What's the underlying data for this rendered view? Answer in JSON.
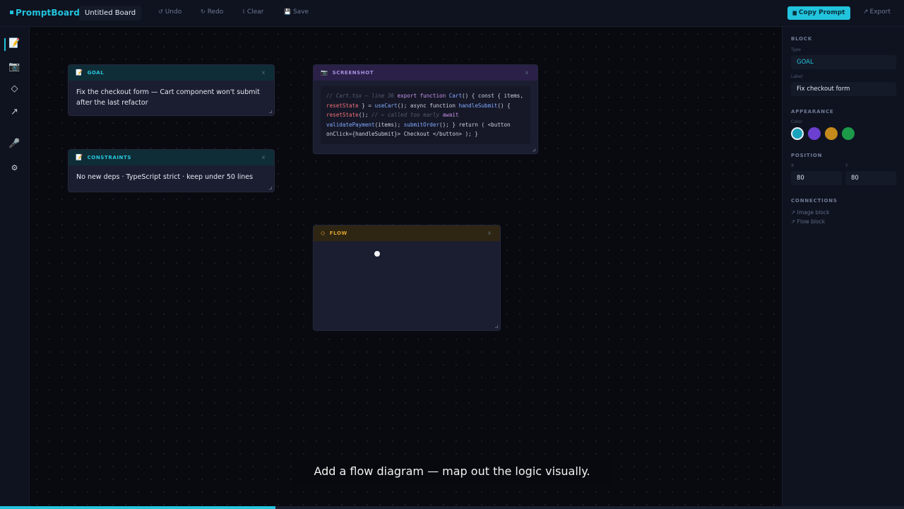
{
  "app": {
    "name": "PromptBoard",
    "board_name": "Untitled Board"
  },
  "toolbar": {
    "undo_icon": "↺",
    "undo_label": "Undo",
    "redo_icon": "↻",
    "redo_label": "Redo",
    "clear_icon": "⌇",
    "clear_label": "Clear",
    "save_icon": "💾",
    "save_label": "Save",
    "copy_prompt_icon": "▆",
    "copy_prompt_label": "Copy Prompt",
    "export_icon": "↗",
    "export_label": "Export"
  },
  "leftbar": {
    "items": [
      {
        "name": "text-block-tool",
        "icon": "📝"
      },
      {
        "name": "image-block-tool",
        "icon": "📷"
      },
      {
        "name": "flow-block-tool",
        "icon": "◇"
      },
      {
        "name": "arrow-tool",
        "icon": "↗"
      },
      {
        "name": "voice-tool",
        "icon": "🎤"
      },
      {
        "name": "settings-tool",
        "icon": "⚙"
      }
    ]
  },
  "blocks": {
    "goal": {
      "icon": "📝",
      "title": "GOAL",
      "close": "x",
      "body": "Fix the checkout form — Cart component won't submit after the last refactor"
    },
    "constraints": {
      "icon": "📝",
      "title": "CONSTRAINTS",
      "close": "x",
      "body": "No new deps · TypeScript strict · keep under 50 lines"
    },
    "screenshot": {
      "icon": "📷",
      "title": "SCREENSHOT",
      "close": "x",
      "code": {
        "c1": "// Cart.tsx — line 36",
        "t1": " export function ",
        "f1": "Cart",
        "t2": "() { const { items, ",
        "v1": "resetState",
        "t3": " } = ",
        "f2": "useCart",
        "t4": "(); async function ",
        "f3": "handleSubmit",
        "t5": "() { ",
        "v2": "resetState",
        "t6": "(); ",
        "c2": "// ← called too early",
        "k1": " await",
        "t7": " ",
        "f4": "validatePayment",
        "t8": "(items); ",
        "f5": "submitOrder",
        "t9": "(); } return ( <button onClick={handleSubmit}> Checkout </button> ); }"
      }
    },
    "flow": {
      "icon": "◇",
      "title": "FLOW",
      "close": "x"
    }
  },
  "panel": {
    "block_section": "BLOCK",
    "type_label": "Type",
    "type_value": "GOAL",
    "label_label": "Label",
    "label_value": "Fix checkout form",
    "appearance_section": "APPEARANCE",
    "color_label": "Color",
    "colors": [
      "#1aa3bc",
      "#6b3fd0",
      "#c48a1c",
      "#1c9a4a"
    ],
    "position_section": "POSITION",
    "x_label": "X",
    "x_value": "80",
    "y_label": "Y",
    "y_value": "80",
    "connections_section": "CONNECTIONS",
    "connections": [
      "↗ Image block",
      "↗ Flow block"
    ]
  },
  "caption": "Add a flow diagram — map out the logic visually.",
  "playback": {
    "progress_fraction": 0.305
  },
  "colors": {
    "accent": "#22c3dd",
    "goal": "#29c6de",
    "screenshot": "#a990e0",
    "flow": "#e0a531"
  }
}
